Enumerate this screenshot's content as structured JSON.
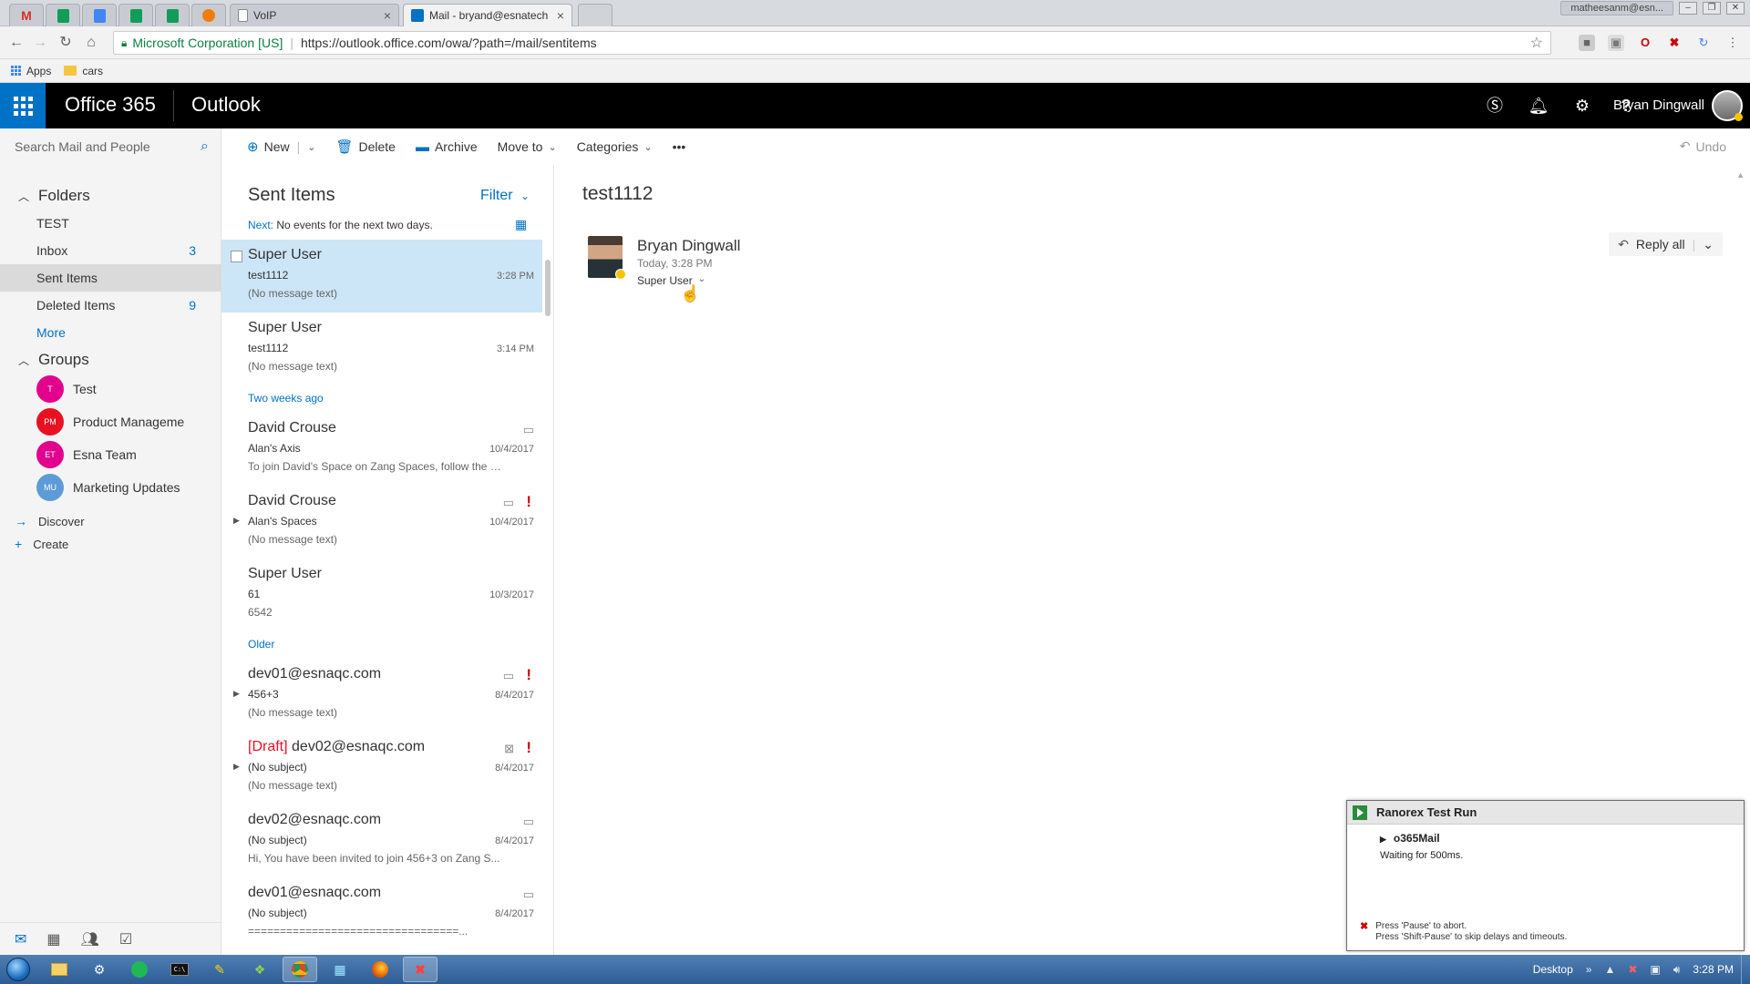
{
  "browser": {
    "tabs": [
      {
        "kind": "gmail",
        "color": "#ffffff",
        "glyph": "M",
        "glyph_color": "#d93025"
      },
      {
        "kind": "sheets",
        "color": "#0f9d58",
        "glyph": "▦",
        "glyph_color": "#ffffff"
      },
      {
        "kind": "docs",
        "color": "#4285f4",
        "glyph": "≡",
        "glyph_color": "#ffffff"
      },
      {
        "kind": "sheets",
        "color": "#0f9d58",
        "glyph": "▦",
        "glyph_color": "#ffffff"
      },
      {
        "kind": "sheets",
        "color": "#0f9d58",
        "glyph": "▦",
        "glyph_color": "#ffffff"
      },
      {
        "kind": "orange-app",
        "color": "#f57c00",
        "glyph": "◆",
        "glyph_color": "#ffffff"
      }
    ],
    "tab_voip": "VoIP",
    "tab_mail": "Mail - bryand@esnatech",
    "profile_chip": "matheesanm@esn...",
    "address": {
      "org": "Microsoft Corporation [US]",
      "url": "https://outlook.office.com/owa/?path=/mail/sentitems"
    },
    "bookmarks": {
      "apps": "Apps",
      "cars": "cars"
    }
  },
  "o365": {
    "brand": "Office 365",
    "app": "Outlook",
    "user": "Bryan Dingwall",
    "icons": [
      "skype-icon",
      "bell-icon",
      "gear-icon",
      "help-icon"
    ]
  },
  "nav": {
    "search_placeholder": "Search Mail and People",
    "folders_label": "Folders",
    "folders": [
      {
        "name": "TEST",
        "count": ""
      },
      {
        "name": "Inbox",
        "count": "3"
      },
      {
        "name": "Sent Items",
        "count": ""
      },
      {
        "name": "Deleted Items",
        "count": "9"
      },
      {
        "name": "More",
        "count": ""
      }
    ],
    "groups_label": "Groups",
    "groups": [
      {
        "initials": "T",
        "name": "Test",
        "color": "#e3008c"
      },
      {
        "initials": "PM",
        "name": "Product Manageme",
        "color": "#e81123"
      },
      {
        "initials": "ET",
        "name": "Esna Team",
        "color": "#e3008c"
      },
      {
        "initials": "MU",
        "name": "Marketing Updates",
        "color": "#5c9bd5"
      }
    ],
    "discover": "Discover",
    "create": "Create"
  },
  "commands": {
    "new": "New",
    "delete": "Delete",
    "archive": "Archive",
    "move_to": "Move to",
    "categories": "Categories",
    "more": "•••",
    "undo": "Undo"
  },
  "list": {
    "title": "Sent Items",
    "filter": "Filter",
    "next_label": "Next:",
    "next_text": "No events for the next two days.",
    "group_two_weeks": "Two weeks ago",
    "group_older": "Older",
    "messages": [
      {
        "from": "Super User",
        "subject": "test1112",
        "preview": "(No message text)",
        "time": "3:28 PM"
      },
      {
        "from": "Super User",
        "subject": "test1112",
        "preview": "(No message text)",
        "time": "3:14 PM"
      },
      {
        "from": "David Crouse",
        "subject": "Alan's Axis",
        "preview": "To join David's Space on Zang Spaces, follow the lin...",
        "time": "10/4/2017"
      },
      {
        "from": "David Crouse",
        "subject": "Alan's Spaces",
        "preview": "(No message text)",
        "time": "10/4/2017"
      },
      {
        "from": "Super User",
        "subject": "61",
        "preview": "6542",
        "time": "10/3/2017"
      },
      {
        "from": "dev01@esnaqc.com",
        "subject": "456+3",
        "preview": "(No message text)",
        "time": "8/4/2017"
      },
      {
        "draft": "[Draft]",
        "from": "dev02@esnaqc.com",
        "subject": "(No subject)",
        "preview": "(No message text)",
        "time": "8/4/2017"
      },
      {
        "from": "dev02@esnaqc.com",
        "subject": "(No subject)",
        "preview": "Hi, You have been invited to join 456+3 on Zang S...",
        "time": "8/4/2017"
      },
      {
        "from": "dev01@esnaqc.com",
        "subject": "(No subject)",
        "preview": "=================================...",
        "time": "8/4/2017"
      }
    ]
  },
  "reading": {
    "subject": "test1112",
    "from": "Bryan Dingwall",
    "date": "Today, 3:28 PM",
    "to": "Super User",
    "reply_all": "Reply all"
  },
  "ranorex": {
    "title": "Ranorex Test Run",
    "item": "o365Mail",
    "status": "Waiting for 500ms.",
    "foot1": "Press 'Pause' to abort.",
    "foot2": "Press 'Shift-Pause' to skip delays and timeouts."
  },
  "taskbar": {
    "desktop": "Desktop",
    "time": "3:28 PM"
  },
  "colors": {
    "accent": "#0072c6",
    "header": "#000000",
    "selected_message": "#cde6f7",
    "importance": "#cc0000"
  }
}
